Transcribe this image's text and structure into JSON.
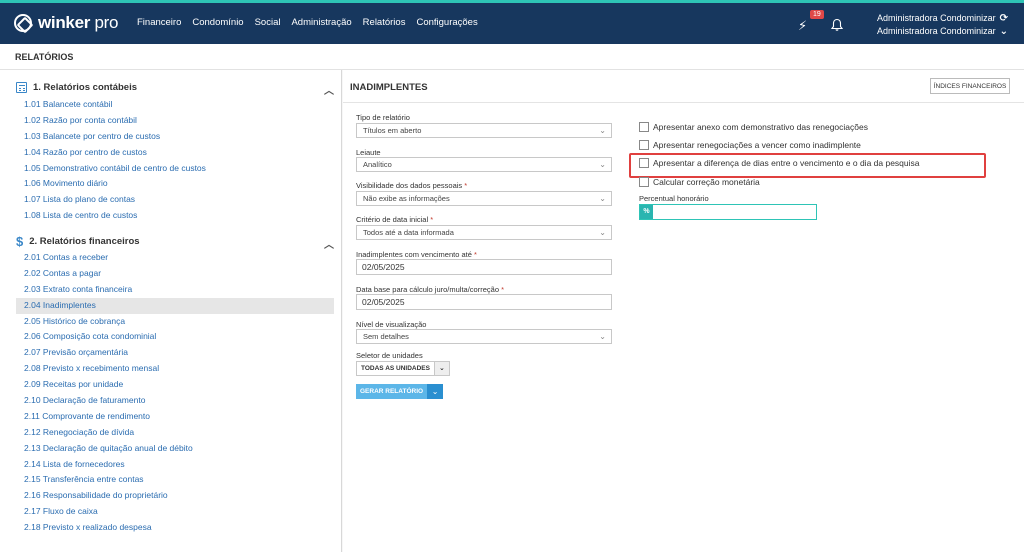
{
  "app": {
    "logo_main": "winker",
    "logo_sub": "pro",
    "menu": [
      "Financeiro",
      "Condomínio",
      "Social",
      "Administração",
      "Relatórios",
      "Configurações"
    ],
    "notifications_count": "19",
    "user_name": "Administradora Condominizar",
    "user_role": "Administradora Condominizar"
  },
  "page": {
    "title": "RELATÓRIOS"
  },
  "sidebar": {
    "section1": {
      "title": "1. Relatórios contábeis",
      "items": [
        "1.01 Balancete contábil",
        "1.02 Razão por conta contábil",
        "1.03 Balancete por centro de custos",
        "1.04 Razão por centro de custos",
        "1.05 Demonstrativo contábil de centro de custos",
        "1.06 Movimento diário",
        "1.07 Lista do plano de contas",
        "1.08 Lista de centro de custos"
      ]
    },
    "section2": {
      "title": "2. Relatórios financeiros",
      "items": [
        "2.01 Contas a receber",
        "2.02 Contas a pagar",
        "2.03 Extrato conta financeira",
        "2.04 Inadimplentes",
        "2.05 Histórico de cobrança",
        "2.06 Composição cota condominial",
        "2.07 Previsão orçamentária",
        "2.08 Previsto x recebimento mensal",
        "2.09 Receitas por unidade",
        "2.10 Declaração de faturamento",
        "2.11 Comprovante de rendimento",
        "2.12 Renegociação de dívida",
        "2.13 Declaração de quitação anual de débito",
        "2.14 Lista de fornecedores",
        "2.15 Transferência entre contas",
        "2.16 Responsabilidade do proprietário",
        "2.17 Fluxo de caixa",
        "2.18 Previsto x realizado despesa"
      ],
      "active": "2.04 Inadimplentes"
    }
  },
  "main": {
    "title": "INADIMPLENTES",
    "indices_button": "ÍNDICES FINANCEIROS",
    "tipo_label": "Tipo de relatório",
    "tipo_value": "Títulos em aberto",
    "leiaute_label": "Leiaute",
    "leiaute_value": "Analítico",
    "visib_label": "Visibilidade dos dados pessoais",
    "visib_value": "Não exibe as informações",
    "criterio_label": "Critério de data inicial",
    "criterio_value": "Todos até a data informada",
    "venc_label": "Inadimplentes com vencimento até",
    "venc_value": "02/05/2025",
    "database_label": "Data base para cálculo juro/multa/correção",
    "database_value": "02/05/2025",
    "nivel_label": "Nível de visualização",
    "nivel_value": "Sem detalhes",
    "seletor_label": "Seletor de unidades",
    "seletor_value": "TODAS AS UNIDADES",
    "gerar_button": "GERAR RELATÓRIO",
    "checks": [
      "Apresentar anexo com demonstrativo das renegociações",
      "Apresentar renegociações a vencer como inadimplente",
      "Apresentar a diferença de dias entre o vencimento e o dia da pesquisa",
      "Calcular correção monetária"
    ],
    "honorario_label": "Percentual honorário",
    "honorario_symbol": "%"
  },
  "colors": {
    "navbar": "#17375e",
    "accent": "#2ec4b6",
    "link": "#2a6cb0",
    "highlight": "#e0403f"
  }
}
